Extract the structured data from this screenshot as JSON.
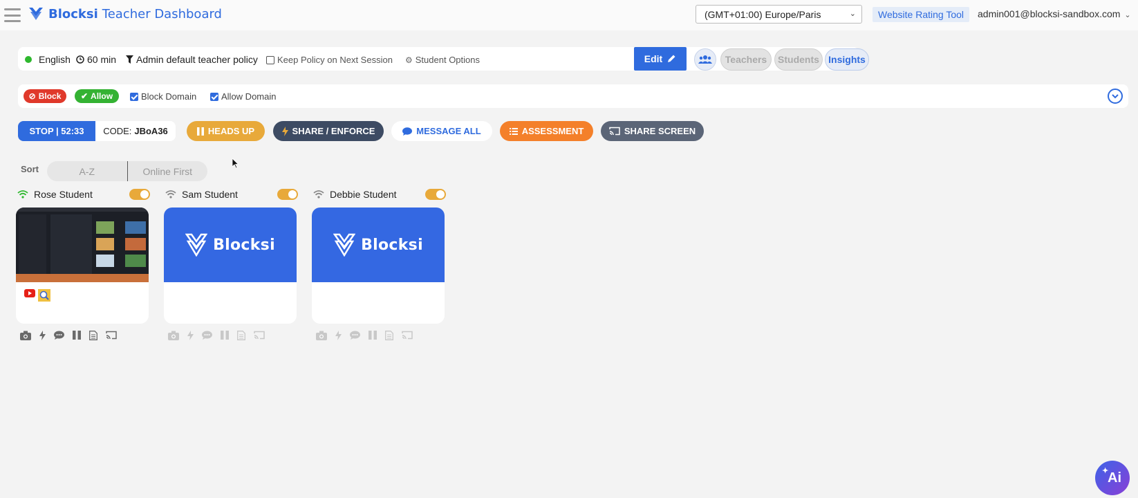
{
  "header": {
    "brand": "Blocksi",
    "title": "Teacher Dashboard",
    "timezone": "(GMT+01:00) Europe/Paris",
    "rating_tool": "Website Rating Tool",
    "account": "admin001@blocksi-sandbox.com"
  },
  "policy": {
    "language": "English",
    "duration": "60 min",
    "policy_name": "Admin default teacher policy",
    "keep_policy": "Keep Policy on Next Session",
    "student_options": "Student Options",
    "edit": "Edit"
  },
  "view_tabs": [
    {
      "label": "Teachers",
      "state": "muted"
    },
    {
      "label": "Students",
      "state": "muted"
    },
    {
      "label": "Insights",
      "state": "active"
    }
  ],
  "domains": {
    "block": "Block",
    "allow": "Allow",
    "block_domain": "Block Domain",
    "allow_domain": "Allow Domain"
  },
  "session": {
    "stop": "STOP | 52:33",
    "code_label": "CODE:",
    "code_value": "JBoA36"
  },
  "actions": {
    "heads_up": "HEADS UP",
    "share_enforce": "SHARE / ENFORCE",
    "message_all": "MESSAGE ALL",
    "assessment": "ASSESSMENT",
    "share_screen": "SHARE SCREEN"
  },
  "sort": {
    "label": "Sort",
    "options": [
      "A-Z",
      "Online First"
    ]
  },
  "students": [
    {
      "name": "Rose Student",
      "online": true,
      "screen": "screenshot"
    },
    {
      "name": "Sam Student",
      "online": false,
      "screen": "Blocksi"
    },
    {
      "name": "Debbie Student",
      "online": false,
      "screen": "Blocksi"
    }
  ],
  "ai_button": "Ai",
  "colors": {
    "primary": "#2f6bde",
    "block": "#e0392b",
    "allow": "#34b233",
    "heads_up": "#e8a93a",
    "share": "#3d4b63",
    "assessment": "#f4802a",
    "share_screen": "#5b6577"
  }
}
